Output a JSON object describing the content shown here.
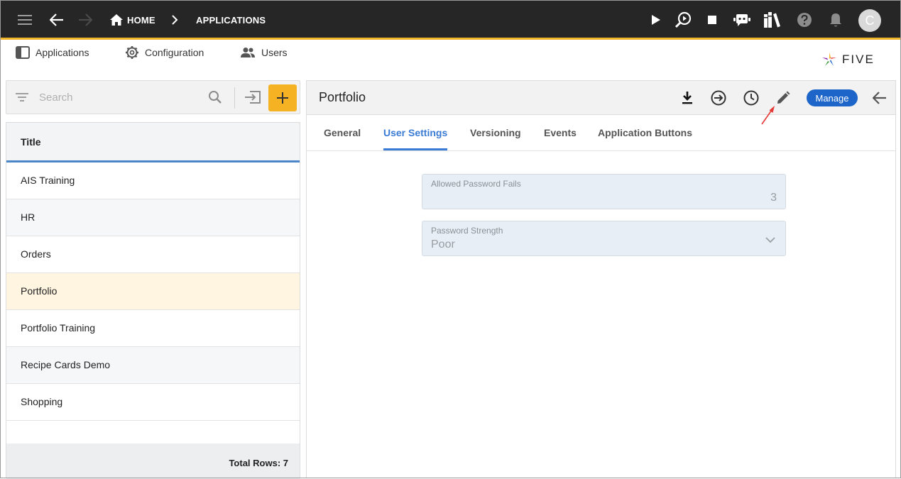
{
  "topbar": {
    "home_label": "HOME",
    "applications_label": "APPLICATIONS",
    "avatar_initial": "C"
  },
  "menu": {
    "items": [
      {
        "label": "Applications",
        "icon": "panel-icon"
      },
      {
        "label": "Configuration",
        "icon": "gear-icon"
      },
      {
        "label": "Users",
        "icon": "users-icon"
      }
    ],
    "logo_text": "FIVE"
  },
  "list": {
    "search_placeholder": "Search",
    "column_title": "Title",
    "rows": [
      {
        "title": "AIS Training"
      },
      {
        "title": "HR"
      },
      {
        "title": "Orders"
      },
      {
        "title": "Portfolio",
        "selected": true
      },
      {
        "title": "Portfolio Training"
      },
      {
        "title": "Recipe Cards Demo"
      },
      {
        "title": "Shopping"
      }
    ],
    "total_rows": "Total Rows: 7"
  },
  "detail": {
    "title": "Portfolio",
    "manage_label": "Manage",
    "tabs": [
      {
        "label": "General"
      },
      {
        "label": "User Settings",
        "active": true
      },
      {
        "label": "Versioning"
      },
      {
        "label": "Events"
      },
      {
        "label": "Application Buttons"
      }
    ],
    "fields": {
      "allowed_password_fails": {
        "label": "Allowed Password Fails",
        "value": "3"
      },
      "password_strength": {
        "label": "Password Strength",
        "value": "Poor"
      }
    }
  },
  "colors": {
    "topbar_bg": "#262626",
    "accent_yellow": "#f5b324",
    "tab_active": "#3a7bd5",
    "manage_blue": "#1d65c9",
    "selected_row": "#fff5e1",
    "annotation_arrow": "#e53935"
  }
}
